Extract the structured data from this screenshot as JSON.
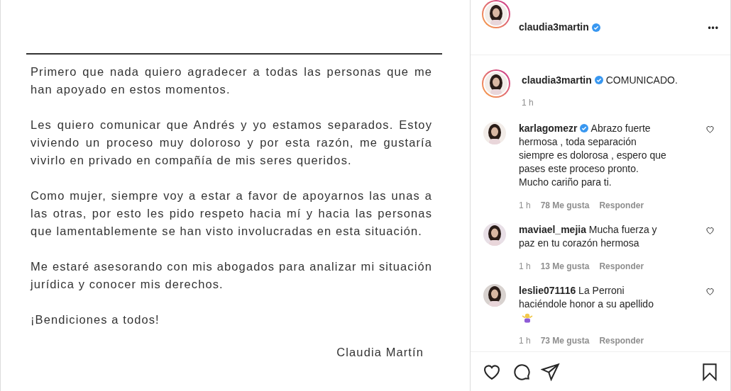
{
  "letter": {
    "paragraphs": [
      "Primero que nada quiero agradecer a todas las personas que me han apoyado en estos momentos.",
      "Les quiero comunicar que Andrés y yo estamos separados. Estoy viviendo un proceso muy doloroso y por esta razón, me gustaría vivirlo en privado en compañía de mis seres queridos.",
      "Como mujer, siempre voy a estar a favor de apoyarnos las unas a las otras, por esto les pido respeto hacia mí y hacia las personas que lamentablemente se han visto involucradas en esta situación.",
      "Me estaré asesorando con mis abogados para analizar mi situación jurídica y conocer mis derechos.",
      "¡Bendiciones a todos!"
    ],
    "signature": "Claudia Martín"
  },
  "header": {
    "username": "claudia3martin",
    "verified": true,
    "menu": "•••"
  },
  "caption": {
    "username": "claudia3martin",
    "verified": true,
    "text": "COMUNICADO.",
    "time": "1 h"
  },
  "comments": [
    {
      "username": "karlagomezr",
      "verified": true,
      "text": "Abrazo fuerte hermosa , toda separación siempre es dolorosa , espero que pases este proceso pronto. Mucho cariño para ti.",
      "emoji": false,
      "time": "1 h",
      "likes": "78 Me gusta",
      "reply": "Responder"
    },
    {
      "username": "maviael_mejia",
      "verified": false,
      "text": "Mucha fuerza y paz en tu corazón hermosa",
      "emoji": false,
      "time": "1 h",
      "likes": "13 Me gusta",
      "reply": "Responder"
    },
    {
      "username": "leslie071116",
      "verified": false,
      "text": "La Perroni haciéndole honor a su apellido",
      "emoji": true,
      "time": "1 h",
      "likes": "73 Me gusta",
      "reply": "Responder"
    }
  ]
}
